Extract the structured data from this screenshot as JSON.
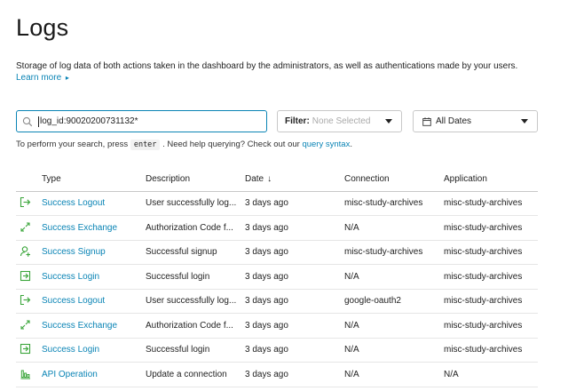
{
  "page": {
    "title": "Logs",
    "intro": "Storage of log data of both actions taken in the dashboard by the administrators, as well as authentications made by your users.",
    "learn_more": "Learn more",
    "learn_more_caret": "▸"
  },
  "search": {
    "value": "log_id:90020200731132*"
  },
  "filter": {
    "label": "Filter:",
    "placeholder": "None Selected"
  },
  "date_filter": {
    "label": "All Dates"
  },
  "help": {
    "prefix": "To perform your search, press",
    "key": "enter",
    "middle": ". Need help querying? Check out our",
    "link": "query syntax",
    "suffix": "."
  },
  "table": {
    "columns": [
      "Type",
      "Description",
      "Date",
      "Connection",
      "Application"
    ],
    "date_sort_arrow": "↓",
    "rows": [
      {
        "icon": "logout-icon",
        "type": "Success Logout",
        "description": "User successfully log...",
        "date": "3 days ago",
        "connection": "misc-study-archives",
        "application": "misc-study-archives"
      },
      {
        "icon": "exchange-icon",
        "type": "Success Exchange",
        "description": "Authorization Code f...",
        "date": "3 days ago",
        "connection": "N/A",
        "application": "misc-study-archives"
      },
      {
        "icon": "signup-icon",
        "type": "Success Signup",
        "description": "Successful signup",
        "date": "3 days ago",
        "connection": "misc-study-archives",
        "application": "misc-study-archives"
      },
      {
        "icon": "login-icon",
        "type": "Success Login",
        "description": "Successful login",
        "date": "3 days ago",
        "connection": "N/A",
        "application": "misc-study-archives"
      },
      {
        "icon": "logout-icon",
        "type": "Success Logout",
        "description": "User successfully log...",
        "date": "3 days ago",
        "connection": "google-oauth2",
        "application": "misc-study-archives"
      },
      {
        "icon": "exchange-icon",
        "type": "Success Exchange",
        "description": "Authorization Code f...",
        "date": "3 days ago",
        "connection": "N/A",
        "application": "misc-study-archives"
      },
      {
        "icon": "login-icon",
        "type": "Success Login",
        "description": "Successful login",
        "date": "3 days ago",
        "connection": "N/A",
        "application": "misc-study-archives"
      },
      {
        "icon": "api-operation-icon",
        "type": "API Operation",
        "description": "Update a connection",
        "date": "3 days ago",
        "connection": "N/A",
        "application": "N/A"
      }
    ]
  },
  "colors": {
    "accent": "#0a84b5",
    "success_icon": "#3aa53a"
  }
}
